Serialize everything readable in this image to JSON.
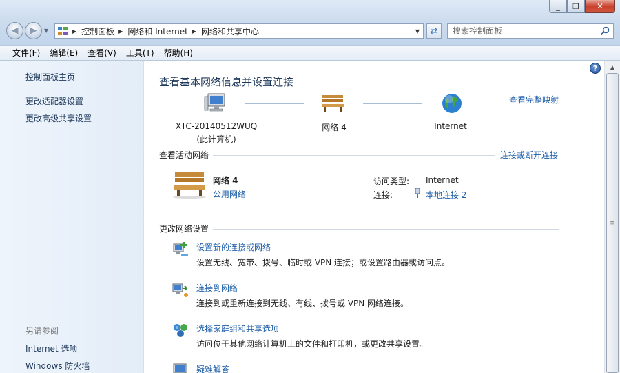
{
  "window": {
    "minimize_glyph": "▭",
    "restore_glyph": "❐",
    "close_glyph": "✕"
  },
  "address_bar": {
    "breadcrumbs": [
      "控制面板",
      "网络和 Internet",
      "网络和共享中心"
    ]
  },
  "search": {
    "placeholder": "搜索控制面板"
  },
  "menu": [
    "文件(F)",
    "编辑(E)",
    "查看(V)",
    "工具(T)",
    "帮助(H)"
  ],
  "sidebar": {
    "home": "控制面板主页",
    "links": [
      "更改适配器设置",
      "更改高级共享设置"
    ],
    "see_also_heading": "另请参阅",
    "see_also": [
      "Internet 选项",
      "Windows 防火墙"
    ]
  },
  "main": {
    "title": "查看基本网络信息并设置连接",
    "full_map_link": "查看完整映射",
    "map_nodes": [
      {
        "label": "XTC-20140512WUQ",
        "sub": "(此计算机)",
        "icon": "computer-icon"
      },
      {
        "label": "网络  4",
        "sub": "",
        "icon": "bench-icon"
      },
      {
        "label": "Internet",
        "sub": "",
        "icon": "globe-icon"
      }
    ],
    "active_networks": {
      "heading": "查看活动网络",
      "connect_link": "连接或断开连接",
      "network_name": "网络  4",
      "network_type": "公用网络",
      "access_type_label": "访问类型:",
      "access_type_value": "Internet",
      "connection_label": "连接:",
      "connection_value": "本地连接 2"
    },
    "change_settings": {
      "heading": "更改网络设置",
      "tasks": [
        {
          "link": "设置新的连接或网络",
          "desc": "设置无线、宽带、拨号、临时或 VPN 连接；或设置路由器或访问点。",
          "icon": "new-connection-icon"
        },
        {
          "link": "连接到网络",
          "desc": "连接到或重新连接到无线、有线、拨号或 VPN 网络连接。",
          "icon": "connect-network-icon"
        },
        {
          "link": "选择家庭组和共享选项",
          "desc": "访问位于其他网络计算机上的文件和打印机，或更改共享设置。",
          "icon": "homegroup-icon"
        },
        {
          "link": "疑难解答",
          "desc": "",
          "icon": "troubleshoot-icon"
        }
      ]
    }
  },
  "colors": {
    "link": "#1f5fa8",
    "title": "#1e395b",
    "sidebar_bg": "#e9f1fa"
  }
}
